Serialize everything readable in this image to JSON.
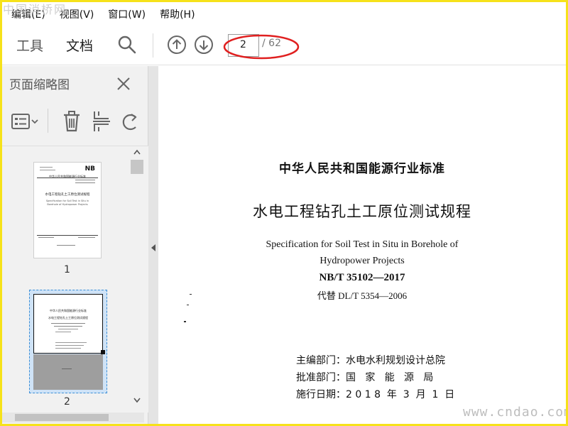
{
  "watermark": {
    "top": "中国消桥网",
    "bottom": "www.cndao.com"
  },
  "menu": [
    "编辑(E)",
    "视图(V)",
    "窗口(W)",
    "帮助(H)"
  ],
  "toolbar": {
    "tabs": [
      "工具",
      "文档"
    ],
    "current_page": "2",
    "total_pages": "/ 62"
  },
  "sidebar": {
    "title": "页面缩略图",
    "thumbnails": [
      {
        "label": "1",
        "badge": "NB",
        "org": "中华人民共和国能源行业标准",
        "title": "水电工程钻孔土工原位测试规程",
        "title_en": "Specification for Soil Test in Situ in Borehole of Hydropower Projects"
      },
      {
        "label": "2",
        "org": "中华人民共和国能源行业标准",
        "title": "水电工程钻孔土工原位测试规程"
      }
    ]
  },
  "document": {
    "org": "中华人民共和国能源行业标准",
    "title": "水电工程钻孔土工原位测试规程",
    "title_en_line1": "Specification for Soil Test in Situ in Borehole of",
    "title_en_line2": "Hydropower Projects",
    "std_number": "NB/T 35102—2017",
    "replaces": "代替 DL/T 5354—2006",
    "compiler": "主编部门：水电水利规划设计总院",
    "approver": "批准部门：国   家   能   源   局",
    "effective": "施行日期：2 0 1 8  年  3  月  1  日"
  },
  "colors": {
    "frame": "#f6e21a",
    "highlight": "#e02020",
    "selection": "#3d8fd6"
  }
}
